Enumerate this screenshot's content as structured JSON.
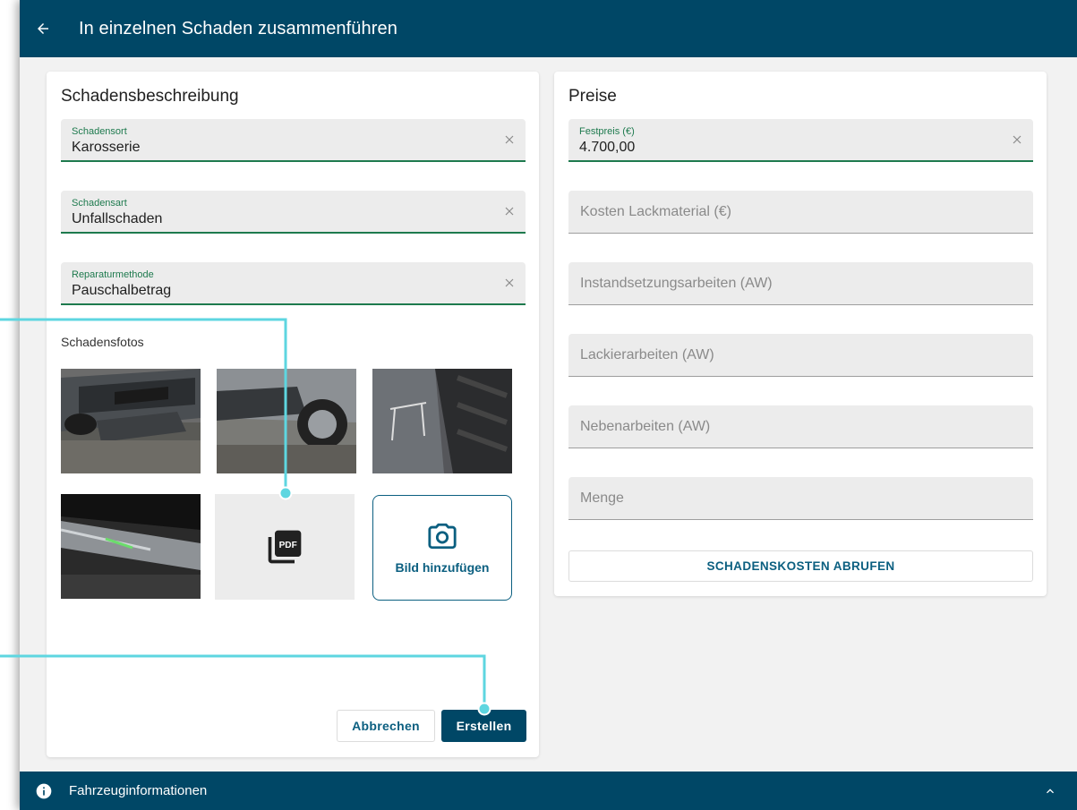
{
  "header": {
    "title": "In einzelnen Schaden zusammenführen",
    "back_icon": "arrow-left-icon"
  },
  "left_card": {
    "heading": "Schadensbeschreibung",
    "fields": [
      {
        "label": "Schadensort",
        "value": "Karosserie"
      },
      {
        "label": "Schadensart",
        "value": "Unfallschaden"
      },
      {
        "label": "Reparaturmethode",
        "value": "Pauschalbetrag"
      }
    ],
    "photos_label": "Schadensfotos",
    "add_photo_label": "Bild hinzufügen",
    "cancel_label": "Abbrechen",
    "create_label": "Erstellen"
  },
  "right_card": {
    "heading": "Preise",
    "fixed_price": {
      "label": "Festpreis (€)",
      "value": "4.700,00"
    },
    "fields": [
      {
        "placeholder": "Kosten Lackmaterial (€)"
      },
      {
        "placeholder": "Instandsetzungsarbeiten (AW)"
      },
      {
        "placeholder": "Lackierarbeiten (AW)"
      },
      {
        "placeholder": "Nebenarbeiten (AW)"
      },
      {
        "placeholder": "Menge"
      }
    ],
    "costs_button": "SCHADENSKOSTEN ABRUFEN"
  },
  "footer": {
    "title": "Fahrzeuginformationen"
  },
  "colors": {
    "primary": "#004766",
    "accent": "#0b5f80",
    "focus": "#1e7a4e",
    "callout": "#5ed6e0"
  }
}
